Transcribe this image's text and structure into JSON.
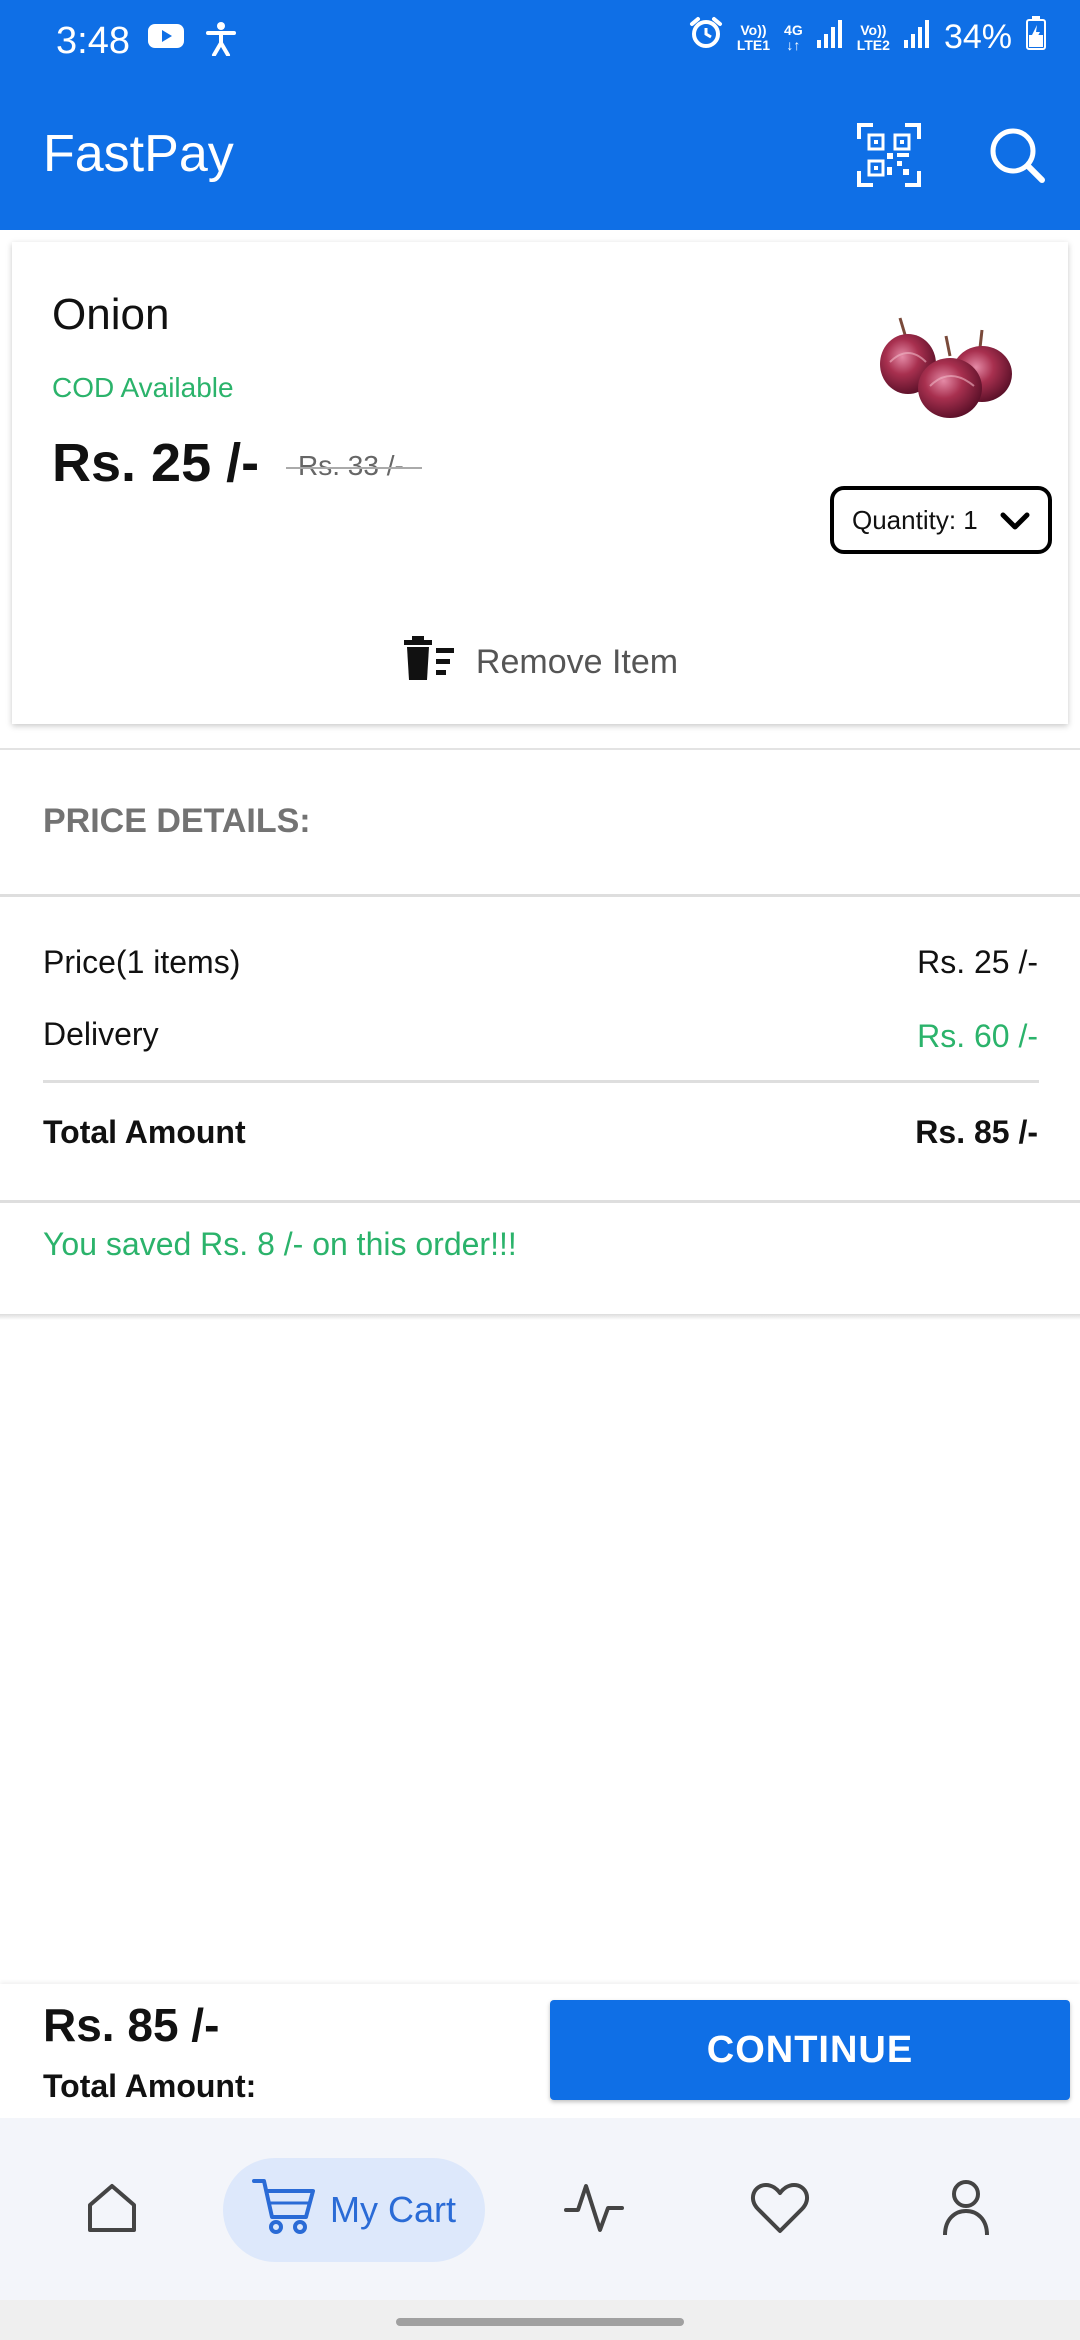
{
  "status_bar": {
    "time": "3:48",
    "battery": "34%",
    "net1_top": "Vo))",
    "net1_bottom": "LTE1",
    "net_type": "4G",
    "net2_top": "Vo))",
    "net2_bottom": "LTE2"
  },
  "app_bar": {
    "title": "FastPay",
    "icons": [
      "qr-scan-icon",
      "search-icon"
    ]
  },
  "cart_item": {
    "name": "Onion",
    "cod": "COD Available",
    "price": "Rs. 25 /-",
    "original_price": "Rs. 33 /-",
    "quantity": "Quantity: 1",
    "remove_label": "Remove Item"
  },
  "price_details": {
    "header": "PRICE DETAILS:",
    "rows": [
      {
        "label": "Price(1 items)",
        "value": "Rs. 25 /-"
      },
      {
        "label": "Delivery",
        "value": "Rs. 60 /-"
      }
    ],
    "total_label": "Total Amount",
    "total_value": "Rs. 85 /-",
    "savings": "You saved Rs. 8 /- on this order!!!"
  },
  "checkout": {
    "amount": "Rs. 85 /-",
    "label": "Total Amount:",
    "button": "CONTINUE"
  },
  "bottom_nav": {
    "items": [
      {
        "icon": "home-icon",
        "label": ""
      },
      {
        "icon": "cart-icon",
        "label": "My Cart"
      },
      {
        "icon": "activity-icon",
        "label": ""
      },
      {
        "icon": "heart-icon",
        "label": ""
      },
      {
        "icon": "user-icon",
        "label": ""
      }
    ],
    "active": "My Cart"
  },
  "colors": {
    "primary": "#0f6fe6",
    "accent_green": "#2bb36b",
    "nav_active_bg": "#dde8fb"
  }
}
